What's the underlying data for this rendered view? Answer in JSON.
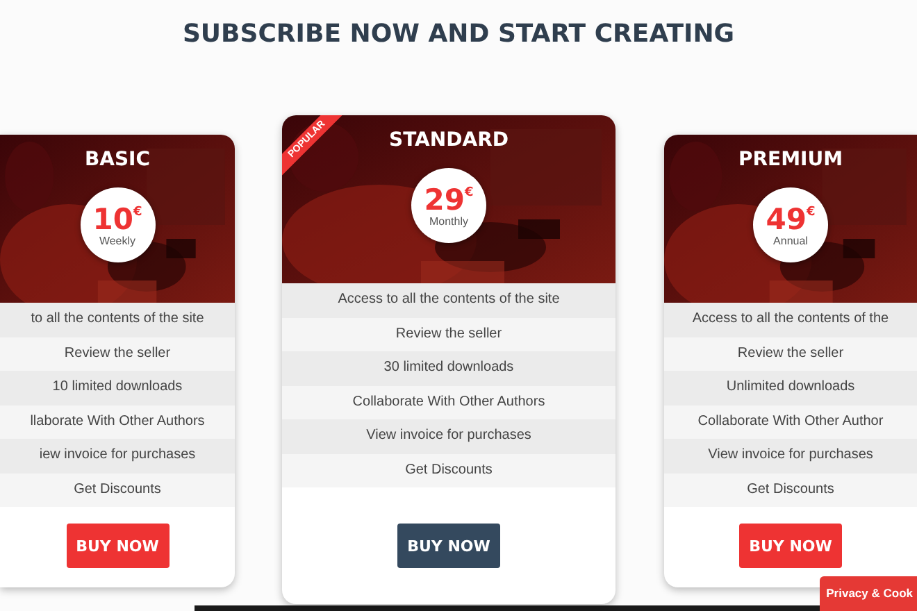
{
  "heading": "SUBSCRIBE NOW AND START CREATING",
  "plans": [
    {
      "name": "BASIC",
      "price": "10",
      "currency": "€",
      "period": "Weekly",
      "popular": false,
      "features": [
        "to all the contents of the site",
        "Review the seller",
        "10 limited downloads",
        "llaborate With Other Authors",
        "iew invoice for purchases",
        "Get Discounts"
      ],
      "button": "BUY NOW",
      "kind": "edge-left"
    },
    {
      "name": "STANDARD",
      "price": "29",
      "currency": "€",
      "period": "Monthly",
      "popular": true,
      "ribbon": "POPULAR",
      "features": [
        "Access to all the contents of the site",
        "Review the seller",
        "30 limited downloads",
        "Collaborate With Other Authors",
        "View invoice for purchases",
        "Get Discounts"
      ],
      "button": "BUY NOW",
      "kind": "full"
    },
    {
      "name": "PREMIUM",
      "price": "49",
      "currency": "€",
      "period": "Annual",
      "popular": false,
      "features": [
        "Access to all the contents of the",
        "Review the seller",
        "Unlimited downloads",
        "Collaborate With Other Author",
        "View invoice for purchases",
        "Get Discounts"
      ],
      "button": "BUY NOW",
      "kind": "edge-right"
    }
  ],
  "cookie_badge": "Privacy & Cook"
}
